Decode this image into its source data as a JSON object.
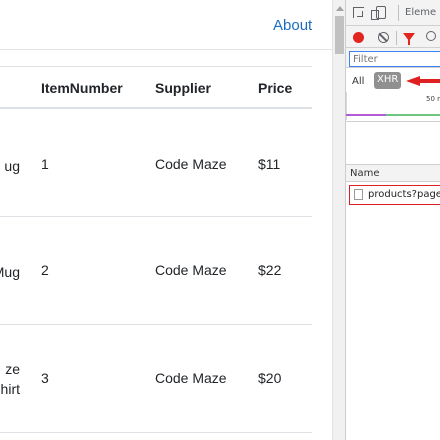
{
  "page": {
    "nav": {
      "about_link": "About"
    },
    "table": {
      "headers": {
        "item_number": "ItemNumber",
        "supplier": "Supplier",
        "price": "Price"
      },
      "rows": [
        {
          "name_fragment": "ug",
          "item_number": "1",
          "supplier": "Code Maze",
          "price": "$11"
        },
        {
          "name_fragment": "Mug",
          "item_number": "2",
          "supplier": "Code Maze",
          "price": "$22"
        },
        {
          "name_fragment": "ze\nhirt",
          "name_line1": "ze",
          "name_line2": "hirt",
          "item_number": "3",
          "supplier": "Code Maze",
          "price": "$20"
        }
      ]
    }
  },
  "devtools": {
    "tab_label": "Eleme",
    "filter_placeholder": "Filter",
    "type_filters": {
      "all": "All",
      "xhr": "XHR"
    },
    "timeline_tick": "50 r",
    "list_header": "Name",
    "request_name": "products?pageS",
    "colors": {
      "record": "#e0261f",
      "highlight": "#e02020",
      "filter_border": "#3b82f6"
    }
  }
}
